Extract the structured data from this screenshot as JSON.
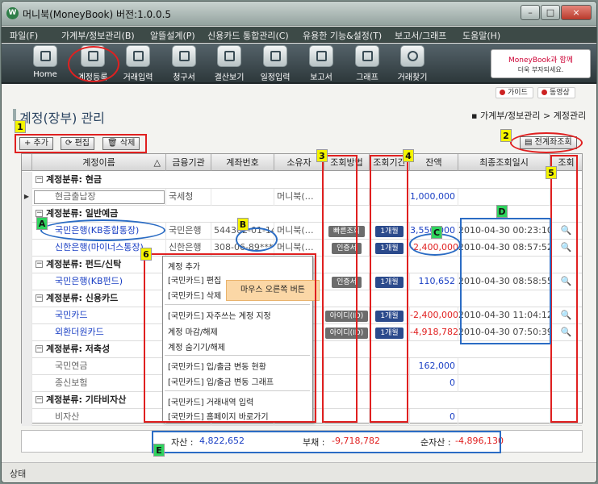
{
  "window": {
    "title": "머니북(MoneyBook) 버전:1.0.0.5",
    "minimize": "–",
    "maximize": "□",
    "close": "×"
  },
  "menu": [
    "파일(F)",
    "가계부/정보관리(B)",
    "알뜰설계(P)",
    "신용카드 통합관리(C)",
    "유용한 기능&설정(T)",
    "보고서/그래프",
    "도움말(H)"
  ],
  "toolbar": [
    "Home",
    "계정등록",
    "거래입력",
    "청구서",
    "결산보기",
    "일정입력",
    "보고서",
    "그래프",
    "거래찾기"
  ],
  "banner": {
    "line1": "MoneyBook과 함께",
    "line2": "더욱 부자되세요."
  },
  "sub_buttons": [
    "가이드",
    "동영상"
  ],
  "page": {
    "title": "계정(장부) 관리",
    "breadcrumb": "▪ 가계부/정보관리 > 계정관리"
  },
  "actions": {
    "add": "+ 추가",
    "edit": "편집",
    "delete": "삭제",
    "all_lookup": "전계좌조회"
  },
  "columns": [
    "계정이름",
    "금융기관",
    "계좌번호",
    "소유자",
    "조회방법",
    "조회기간",
    "잔액",
    "최종조회일시",
    "조회"
  ],
  "sort_indicator": "△",
  "rows": [
    {
      "type": "group",
      "label": "계정분류: 현금"
    },
    {
      "type": "item",
      "name": "현금출납장",
      "bank": "국세청",
      "acct": "",
      "owner": "머니북(…",
      "method": "",
      "period": "",
      "balance": "1,000,000",
      "last": "",
      "lookup": false
    },
    {
      "type": "group",
      "label": "계정분류: 일반예금"
    },
    {
      "type": "item",
      "name": "국민은행(KB종합통장)",
      "bank": "국민은행",
      "acct": "544302-01-14…",
      "owner": "머니북(…",
      "method": "빠른조회",
      "period": "1개월",
      "balance": "3,550,000",
      "last": "2010-04-30 00:23:10",
      "lookup": true
    },
    {
      "type": "item",
      "name": "신한은행(마이너스통장)",
      "bank": "신한은행",
      "acct": "308-06-89***3",
      "owner": "머니북(…",
      "method": "인증서",
      "period": "1개월",
      "balance": "-2,400,000",
      "last": "2010-04-30 08:57:52",
      "lookup": true
    },
    {
      "type": "group",
      "label": "계정분류: 펀드/신탁"
    },
    {
      "type": "item",
      "name": "국민은행(KB펀드)",
      "bank": "",
      "acct": "",
      "owner": "",
      "method": "인증서",
      "period": "1개월",
      "balance": "110,652",
      "last": "2010-04-30 08:58:55",
      "lookup": true
    },
    {
      "type": "group",
      "label": "계정분류: 신용카드"
    },
    {
      "type": "item",
      "name": "국민카드",
      "bank": "",
      "acct": "",
      "owner": "",
      "method": "아이디(ID)",
      "period": "1개월",
      "balance": "-2,400,000",
      "last": "2010-04-30 11:04:12",
      "lookup": true
    },
    {
      "type": "item",
      "name": "외환더원카드",
      "bank": "",
      "acct": "",
      "owner": "",
      "method": "아이디(ID)",
      "period": "1개월",
      "balance": "-4,918,782",
      "last": "2010-04-30 07:50:39",
      "lookup": true
    },
    {
      "type": "group",
      "label": "계정분류: 저축성"
    },
    {
      "type": "item",
      "name": "국민연금",
      "bank": "",
      "acct": "",
      "owner": "",
      "method": "",
      "period": "",
      "balance": "162,000",
      "last": "",
      "lookup": false
    },
    {
      "type": "item",
      "name": "종신보험",
      "bank": "",
      "acct": "",
      "owner": "",
      "method": "",
      "period": "",
      "balance": "0",
      "last": "",
      "lookup": false
    },
    {
      "type": "group",
      "label": "계정분류: 기타비자산"
    },
    {
      "type": "item",
      "name": "비자산",
      "bank": "",
      "acct": "",
      "owner": "",
      "method": "",
      "period": "",
      "balance": "0",
      "last": "",
      "lookup": false
    }
  ],
  "context_menu": [
    "계정 추가",
    "[국민카드] 편집",
    "[국민카드] 삭제",
    "[국민카드] 자주쓰는 계정 지정",
    "계정 마감/해제",
    "계정 숨기기/해제",
    "[국민카드] 입/출금 변동 현황",
    "[국민카드] 입/출금 변동 그래프",
    "[국민카드] 거래내역 입력",
    "[국민카드] 홈페이지 바로가기"
  ],
  "tooltip": "마우스 오른쪽 버튼",
  "summary": {
    "assets_label": "자산 :",
    "assets": "4,822,652",
    "debt_label": "부채 :",
    "debt": "-9,718,782",
    "net_label": "순자산 :",
    "net": "-4,896,130"
  },
  "status": "상태",
  "annotations": [
    "1",
    "2",
    "3",
    "4",
    "5",
    "6",
    "A",
    "B",
    "C",
    "D",
    "E"
  ],
  "colors": {
    "positive": "#1a3fc4",
    "negative": "#e02020",
    "annotation": "#e02020",
    "annotation_blue": "#2b6cc4"
  }
}
